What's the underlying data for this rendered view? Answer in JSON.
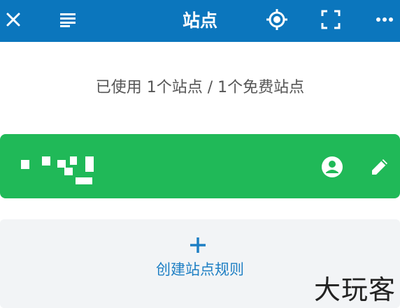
{
  "topbar": {
    "title": "站点",
    "close_icon": "close-icon",
    "list_icon": "list-icon",
    "locate_icon": "locate-icon",
    "scan_icon": "scan-icon",
    "more_icon": "more-icon",
    "color": "#0b76bd"
  },
  "usage": {
    "text": "已使用 1个站点 / 1个免费站点"
  },
  "site_card": {
    "color": "#20b958",
    "account_icon": "account-icon",
    "edit_icon": "edit-icon"
  },
  "create_rule": {
    "label": "创建站点规则",
    "plus_icon": "plus-icon"
  },
  "watermark": {
    "text": "大玩客"
  }
}
